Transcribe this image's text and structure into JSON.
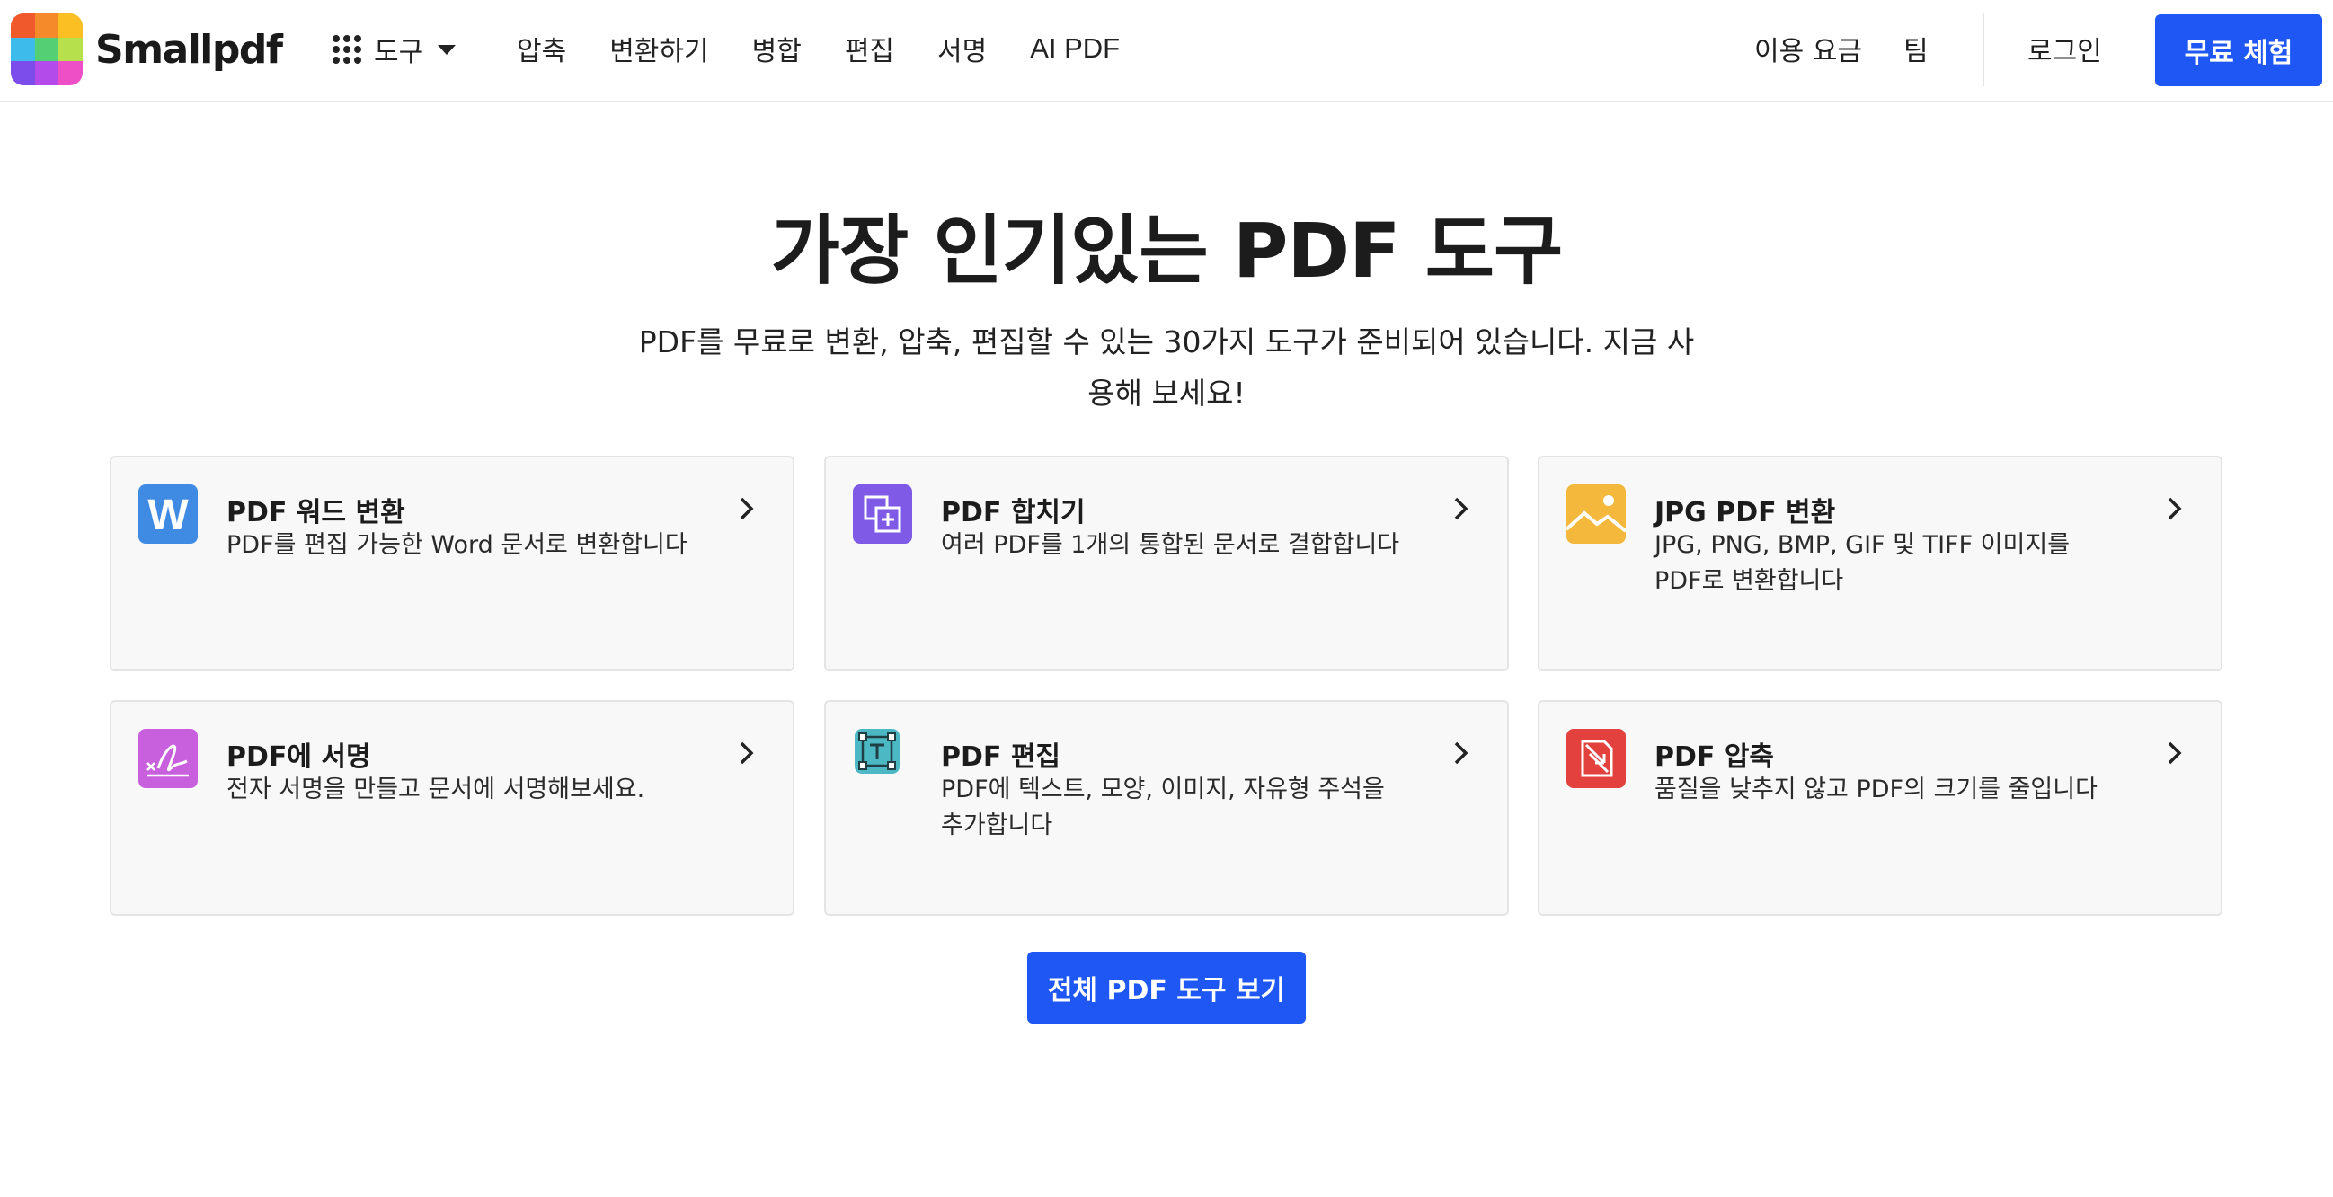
{
  "brand": {
    "name": "Smallpdf",
    "logo_colors": [
      "#f0592b",
      "#f58a2a",
      "#fbbf24",
      "#3dbbea",
      "#55cf74",
      "#b6e14c",
      "#7c4dea",
      "#b24bea",
      "#ee4fc6"
    ]
  },
  "header": {
    "tools_label": "도구",
    "nav": [
      "압축",
      "변환하기",
      "병합",
      "편집",
      "서명",
      "AI PDF"
    ],
    "pricing": "이용 요금",
    "team": "팀",
    "login": "로그인",
    "trial": "무료 체험"
  },
  "hero": {
    "title": "가장 인기있는 PDF 도구",
    "subtitle": "PDF를 무료로 변환, 압축, 편집할 수 있는 30가지 도구가 준비되어 있습니다. 지금 사용해 보세요!"
  },
  "cards": [
    {
      "title": "PDF 워드 변환",
      "desc": "PDF를 편집 가능한 Word 문서로 변환합니다",
      "icon": "word-icon",
      "color": "#3f8ae3"
    },
    {
      "title": "PDF 합치기",
      "desc": "여러 PDF를 1개의 통합된 문서로 결합합니다",
      "icon": "merge-icon",
      "color": "#7e5ae6"
    },
    {
      "title": "JPG PDF 변환",
      "desc": "JPG, PNG, BMP, GIF 및 TIFF 이미지를 PDF로 변환합니다",
      "icon": "image-icon",
      "color": "#f3b83c"
    },
    {
      "title": "PDF에 서명",
      "desc": "전자 서명을 만들고 문서에 서명해보세요.",
      "icon": "signature-icon",
      "color": "#c85fdc"
    },
    {
      "title": "PDF 편집",
      "desc": "PDF에 텍스트, 모양, 이미지, 자유형 주석을 추가합니다",
      "icon": "edit-text-icon",
      "color": "#4cb8c4"
    },
    {
      "title": "PDF 압축",
      "desc": "품질을 낮추지 않고 PDF의 크기를 줄입니다",
      "icon": "compress-icon",
      "color": "#e2413d"
    }
  ],
  "all_tools_button": "전체 PDF 도구 보기",
  "colors": {
    "accent": "#1f57f5"
  }
}
